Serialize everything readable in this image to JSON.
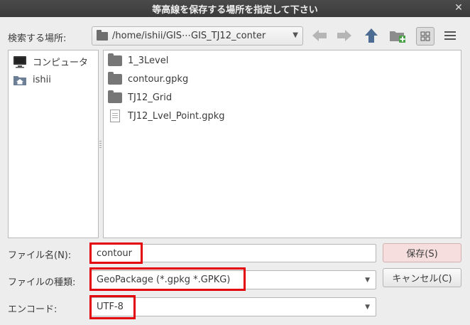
{
  "window": {
    "title": "等高線を保存する場所を指定して下さい",
    "close_glyph": "✕"
  },
  "toolbar": {
    "search_label": "検索する場所:",
    "path": "/home/ishii/GIS⋯GIS_TJ12_conter"
  },
  "places": [
    {
      "label": "コンピュータ",
      "icon": "computer-icon"
    },
    {
      "label": "ishii",
      "icon": "home-folder-icon"
    }
  ],
  "files": [
    {
      "name": "1_3Level",
      "icon": "folder-icon"
    },
    {
      "name": "contour.gpkg",
      "icon": "folder-icon"
    },
    {
      "name": "TJ12_Grid",
      "icon": "folder-icon"
    },
    {
      "name": "TJ12_Lvel_Point.gpkg",
      "icon": "file-icon"
    }
  ],
  "form": {
    "filename_label": "ファイル名(N):",
    "filename_value": "contour",
    "filetype_label": "ファイルの種類:",
    "filetype_value": "GeoPackage (*.gpkg *.GPKG)",
    "encoding_label": "エンコード:",
    "encoding_value": "UTF-8"
  },
  "buttons": {
    "save": "保存(S)",
    "cancel": "キャンセル(C)"
  },
  "colors": {
    "highlight": "#e3000b",
    "title_bg": "#3b3b3b",
    "save_bg": "#f6dede"
  }
}
